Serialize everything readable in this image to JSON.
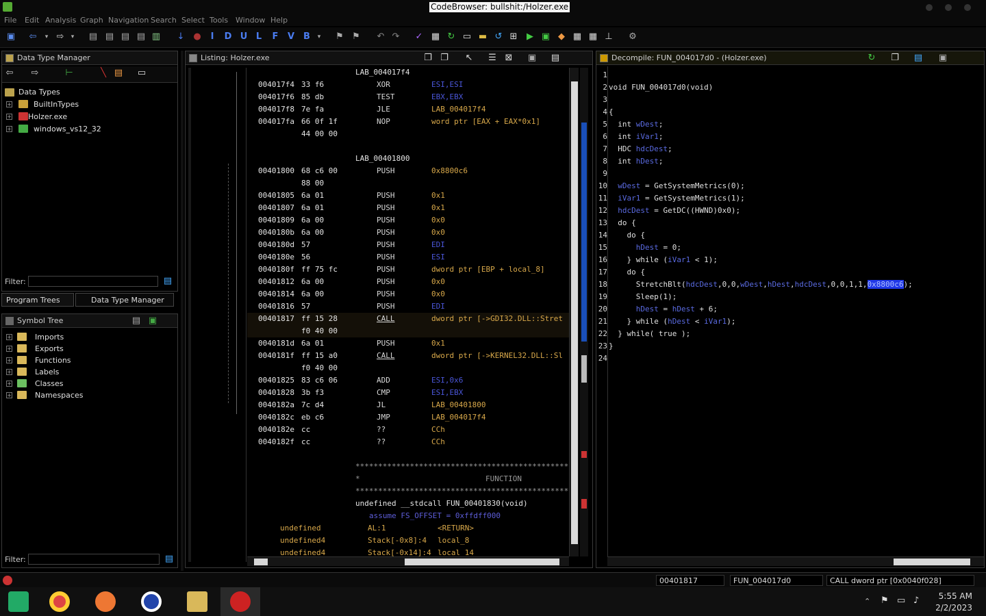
{
  "window": {
    "title": "CodeBrowser: bullshit:/Holzer.exe"
  },
  "menu": [
    "File",
    "Edit",
    "Analysis",
    "Graph",
    "Navigation",
    "Search",
    "Select",
    "Tools",
    "Window",
    "Help"
  ],
  "toolbar_letters": [
    "I",
    "D",
    "U",
    "L",
    "F",
    "V",
    "B"
  ],
  "data_type_manager": {
    "title": "Data Type Manager",
    "root": "Data Types",
    "items": [
      "BuiltInTypes",
      "Holzer.exe",
      "windows_vs12_32"
    ],
    "filter_label": "Filter:"
  },
  "tabs": {
    "program_trees": "Program Trees",
    "data_type_manager": "Data Type Manager"
  },
  "symbol_tree": {
    "title": "Symbol Tree",
    "items": [
      "Imports",
      "Exports",
      "Functions",
      "Labels",
      "Classes",
      "Namespaces"
    ],
    "filter_label": "Filter:"
  },
  "listing": {
    "title": "Listing:  Holzer.exe",
    "rows": [
      {
        "label": "LAB_004017f4"
      },
      {
        "addr": "004017f4",
        "bytes": "33 f6",
        "mnem": "XOR",
        "op": "ESI,ESI"
      },
      {
        "addr": "004017f6",
        "bytes": "85 db",
        "mnem": "TEST",
        "op": "EBX,EBX"
      },
      {
        "addr": "004017f8",
        "bytes": "7e fa",
        "mnem": "JLE",
        "op": "LAB_004017f4"
      },
      {
        "addr": "004017fa",
        "bytes": "66 0f 1f",
        "mnem": "NOP",
        "op": "word ptr [EAX + EAX*0x1]"
      },
      {
        "addr": "",
        "bytes": "44 00 00",
        "mnem": "",
        "op": ""
      },
      {
        "blank": true
      },
      {
        "label": "LAB_00401800"
      },
      {
        "addr": "00401800",
        "bytes": "68 c6 00",
        "mnem": "PUSH",
        "op": "0x8800c6"
      },
      {
        "addr": "",
        "bytes": "88 00",
        "mnem": "",
        "op": ""
      },
      {
        "addr": "00401805",
        "bytes": "6a 01",
        "mnem": "PUSH",
        "op": "0x1"
      },
      {
        "addr": "00401807",
        "bytes": "6a 01",
        "mnem": "PUSH",
        "op": "0x1"
      },
      {
        "addr": "00401809",
        "bytes": "6a 00",
        "mnem": "PUSH",
        "op": "0x0"
      },
      {
        "addr": "0040180b",
        "bytes": "6a 00",
        "mnem": "PUSH",
        "op": "0x0"
      },
      {
        "addr": "0040180d",
        "bytes": "57",
        "mnem": "PUSH",
        "op": "EDI"
      },
      {
        "addr": "0040180e",
        "bytes": "56",
        "mnem": "PUSH",
        "op": "ESI"
      },
      {
        "addr": "0040180f",
        "bytes": "ff 75 fc",
        "mnem": "PUSH",
        "op": "dword ptr [EBP + local_8]"
      },
      {
        "addr": "00401812",
        "bytes": "6a 00",
        "mnem": "PUSH",
        "op": "0x0"
      },
      {
        "addr": "00401814",
        "bytes": "6a 00",
        "mnem": "PUSH",
        "op": "0x0"
      },
      {
        "addr": "00401816",
        "bytes": "57",
        "mnem": "PUSH",
        "op": "EDI"
      },
      {
        "addr": "00401817",
        "bytes": "ff 15 28",
        "mnem": "CALL",
        "op": "dword ptr [->GDI32.DLL::Stret",
        "current": true
      },
      {
        "addr": "",
        "bytes": "f0 40 00",
        "mnem": "",
        "op": "",
        "current": true
      },
      {
        "addr": "0040181d",
        "bytes": "6a 01",
        "mnem": "PUSH",
        "op": "0x1"
      },
      {
        "addr": "0040181f",
        "bytes": "ff 15 a0",
        "mnem": "CALL",
        "op": "dword ptr [->KERNEL32.DLL::Sl"
      },
      {
        "addr": "",
        "bytes": "f0 40 00",
        "mnem": "",
        "op": ""
      },
      {
        "addr": "00401825",
        "bytes": "83 c6 06",
        "mnem": "ADD",
        "op": "ESI,0x6"
      },
      {
        "addr": "00401828",
        "bytes": "3b f3",
        "mnem": "CMP",
        "op": "ESI,EBX"
      },
      {
        "addr": "0040182a",
        "bytes": "7c d4",
        "mnem": "JL",
        "op": "LAB_00401800"
      },
      {
        "addr": "0040182c",
        "bytes": "eb c6",
        "mnem": "JMP",
        "op": "LAB_004017f4"
      },
      {
        "addr": "0040182e",
        "bytes": "cc",
        "mnem": "??",
        "op": "CCh"
      },
      {
        "addr": "0040182f",
        "bytes": "cc",
        "mnem": "??",
        "op": "CCh"
      }
    ],
    "function_header": {
      "stars": "**************************************************************",
      "func_word": "FUNCTION",
      "signature": "undefined __stdcall FUN_00401830(void)",
      "assume": "assume FS_OFFSET = 0xffdff000",
      "params": [
        {
          "type": "undefined",
          "loc": "AL:1",
          "name": "<RETURN>"
        },
        {
          "type": "undefined4",
          "loc": "Stack[-0x8]:4",
          "name": "local_8"
        },
        {
          "type": "undefined4",
          "loc": "Stack[-0x14]:4",
          "name": "local_14"
        }
      ]
    }
  },
  "decompiler": {
    "title": "Decompile: FUN_004017d0 -  (Holzer.exe)",
    "lines": [
      "",
      "void FUN_004017d0(void)",
      "",
      "{",
      "  int wDest;",
      "  int iVar1;",
      "  HDC hdcDest;",
      "  int hDest;",
      "",
      "  wDest = GetSystemMetrics(0);",
      "  iVar1 = GetSystemMetrics(1);",
      "  hdcDest = GetDC((HWND)0x0);",
      "  do {",
      "    do {",
      "      hDest = 0;",
      "    } while (iVar1 < 1);",
      "    do {",
      "      StretchBlt(hdcDest,0,0,wDest,hDest,hdcDest,0,0,1,1,0x8800c6);",
      "      Sleep(1);",
      "      hDest = hDest + 6;",
      "    } while (hDest < iVar1);",
      "  } while( true );",
      "}",
      ""
    ]
  },
  "status": {
    "address": "00401817",
    "function": "FUN_004017d0",
    "instruction": "CALL dword ptr [0x0040f028]"
  },
  "clock": {
    "time": "5:55 AM",
    "date": "2/2/2023"
  }
}
